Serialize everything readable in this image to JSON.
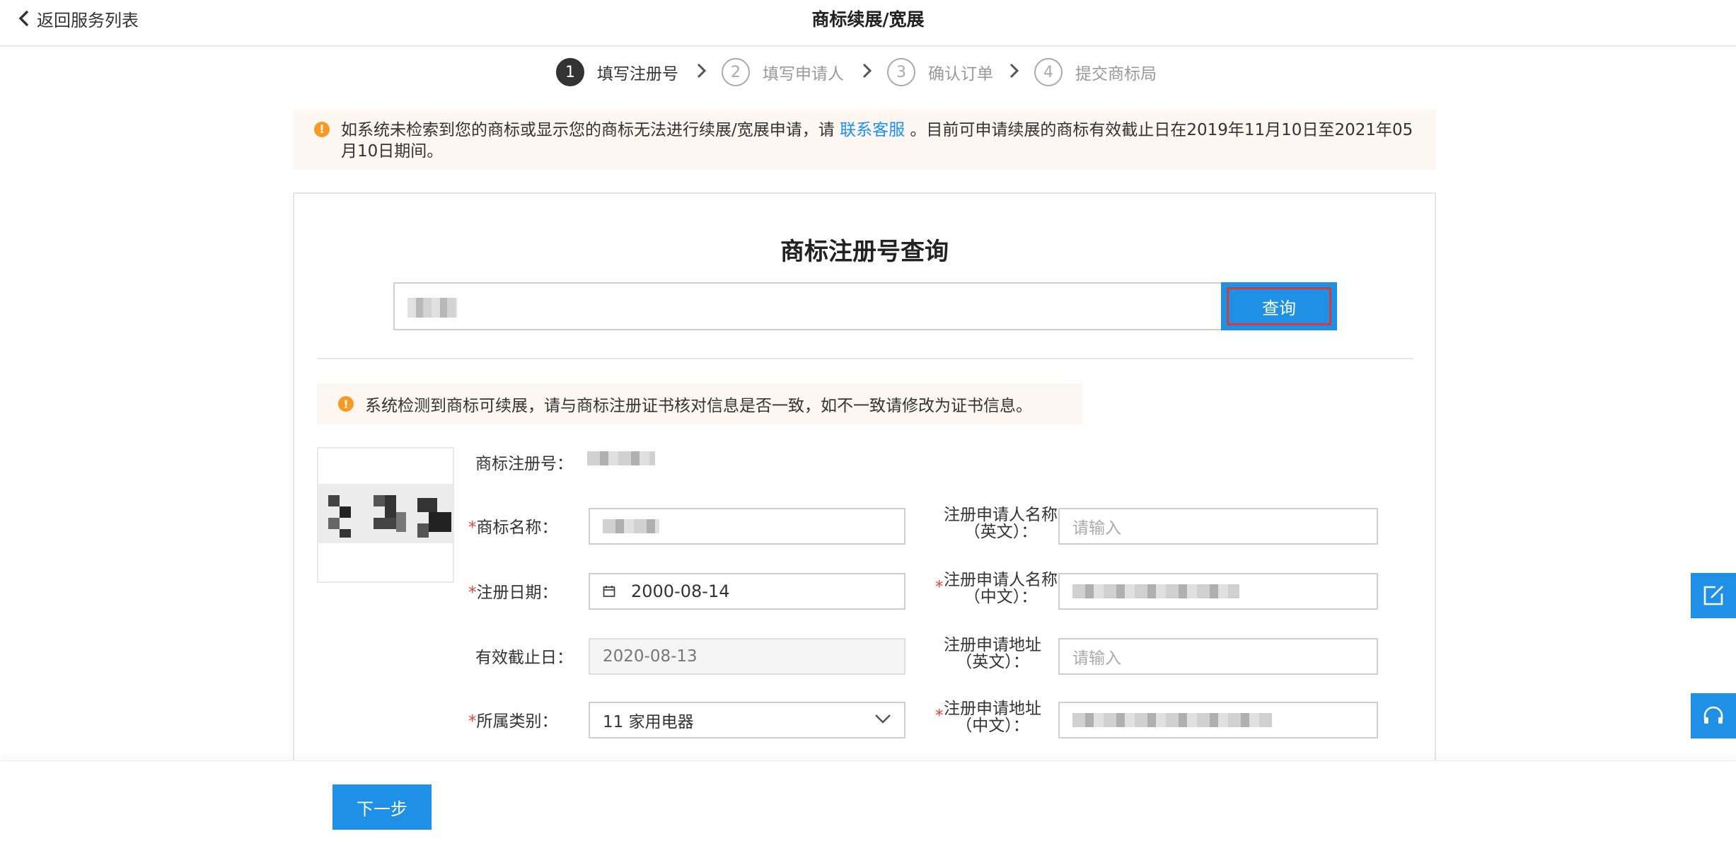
{
  "header": {
    "back_label": "返回服务列表",
    "title": "商标续展/宽展"
  },
  "steps": [
    {
      "num": "1",
      "label": "填写注册号",
      "active": true
    },
    {
      "num": "2",
      "label": "填写申请人",
      "active": false
    },
    {
      "num": "3",
      "label": "确认订单",
      "active": false
    },
    {
      "num": "4",
      "label": "提交商标局",
      "active": false
    }
  ],
  "notice": {
    "icon": "!",
    "text_before": "如系统未检索到您的商标或显示您的商标无法进行续展/宽展申请，请",
    "link": "联系客服",
    "text_after": "。目前可申请续展的商标有效截止日在2019年11月10日至2021年05月10日期间。"
  },
  "query": {
    "title": "商标注册号查询",
    "button": "查询"
  },
  "check_notice": "系统检测到商标可续展，请与商标注册证书核对信息是否一致，如不一致请修改为证书信息。",
  "form": {
    "reg_no_label": "商标注册号：",
    "req_mark": "*",
    "name_label": "商标名称：",
    "reg_date_label": "注册日期：",
    "reg_date_value": "2000-08-14",
    "expiry_label": "有效截止日：",
    "expiry_value": "2020-08-13",
    "category_label": "所属类别：",
    "category_value": "11 家用电器",
    "applicant_en_label_1": "注册申请人名称",
    "applicant_en_label_2": "（英文）：",
    "applicant_cn_label_1": "注册申请人名称",
    "applicant_cn_label_2": "（中文）：",
    "address_en_label_1": "注册申请地址",
    "address_en_label_2": "（英文）：",
    "address_cn_label_1": "注册申请地址",
    "address_cn_label_2": "（中文）：",
    "placeholder": "请输入"
  },
  "footer": {
    "next_label": "下一步"
  },
  "colors": {
    "primary": "#1e90e6",
    "warning": "#f59a23",
    "required": "#e0453a",
    "notice_bg": "#fdf6f1"
  }
}
